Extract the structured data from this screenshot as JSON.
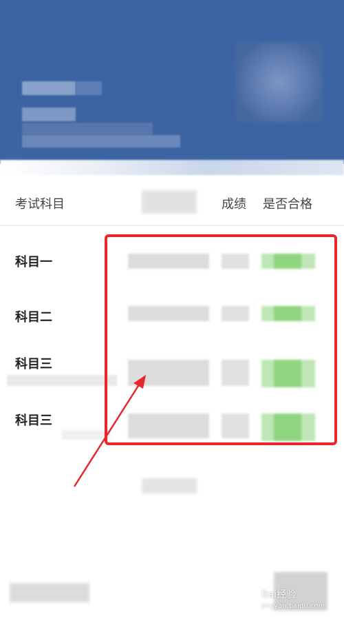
{
  "table": {
    "headers": {
      "subject": "考试科目",
      "score": "成绩",
      "pass": "是否合格"
    },
    "rows": [
      {
        "subject": "科目一"
      },
      {
        "subject": "科目二"
      },
      {
        "subject": "科目三"
      },
      {
        "subject": "科目三"
      }
    ]
  },
  "watermark": {
    "text": "Bai经验",
    "sub": "jingyan.baidu.com"
  },
  "colors": {
    "header_bg": "#3c63a2",
    "highlight": "#e8262b",
    "pass_green": "#8fd47f"
  }
}
